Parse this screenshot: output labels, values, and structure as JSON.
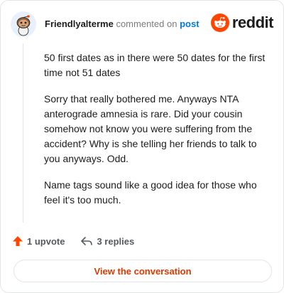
{
  "header": {
    "username": "Friendlyalterme",
    "action_text": "commented on",
    "post_link": "post",
    "logo_text": "reddit"
  },
  "comment": {
    "paragraphs": [
      "50 first dates as in there were 50 dates for the first time not 51 dates",
      "Sorry that really bothered me. Anyways NTA anterograde amnesia is rare. Did your cousin somehow not know you were suffering from the accident? Why is she telling her friends to talk to you anyways. Odd.",
      "Name tags sound like a good idea for those who feel it's too much."
    ]
  },
  "actions": {
    "upvote_label": "1 upvote",
    "replies_label": "3 replies"
  },
  "cta": {
    "label": "View the conversation"
  },
  "icons": {
    "avatar": "snoo-avatar-icon",
    "logo": "reddit-logo-icon",
    "upvote": "upvote-arrow-icon",
    "reply": "reply-arrow-icon"
  },
  "colors": {
    "brand": "#ff4500",
    "link": "#0079d3",
    "cta_text": "#d93a00",
    "muted": "#7c7c7c",
    "border": "#e3e6e8"
  }
}
